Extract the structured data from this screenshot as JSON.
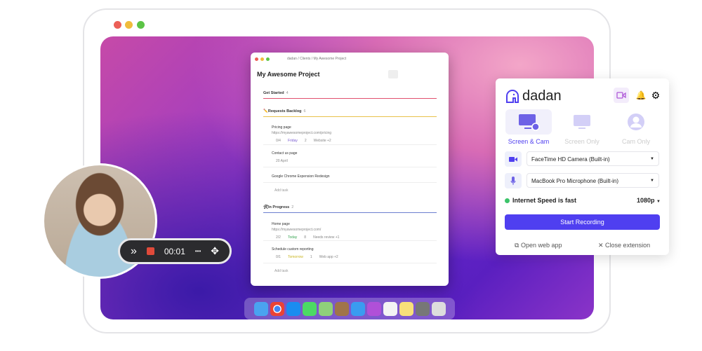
{
  "project_window": {
    "breadcrumb": "dadan / Clients / My Awesome Project",
    "title": "My Awesome Project",
    "sections": [
      {
        "icon": "",
        "name": "Get Started",
        "count": "4",
        "color": "#e0506e"
      },
      {
        "icon": "✏️",
        "name": "Requests Backlog",
        "count": "6",
        "color": "#e9c24a"
      },
      {
        "icon": "🛠",
        "name": "In Progress",
        "count": "2",
        "color": "#6b7fd0"
      }
    ],
    "tasks": [
      {
        "title": "Pricing page",
        "url": "https://myawesomeproject.com/pricing",
        "meta": [
          "0/4",
          "Friday",
          "2",
          "Website +2"
        ]
      },
      {
        "title": "Contact us page",
        "meta": [
          "20 April"
        ]
      },
      {
        "title": "Google Chrome Expension Redesign"
      },
      {
        "title": "Home page",
        "url": "https://myawesomeproject.com/",
        "meta": [
          "2/2",
          "Today",
          "8",
          "Needs review +1"
        ]
      },
      {
        "title": "Schedule custom reporting",
        "meta": [
          "0/1",
          "Tomorrow",
          "1",
          "Web app +2"
        ]
      }
    ],
    "add_task": "Add task"
  },
  "panel": {
    "brand": "dadan",
    "modes": [
      "Screen & Cam",
      "Screen Only",
      "Cam Only"
    ],
    "camera": "FaceTime HD Camera (Built-in)",
    "microphone": "MacBook Pro Microphone (Built-in)",
    "speed": "Internet Speed is fast",
    "resolution": "1080p",
    "start": "Start Recording",
    "open_web": "Open web app",
    "close": "Close extension",
    "accent": "#4f3ff0"
  },
  "recorder": {
    "time": "00:01",
    "more": "•••"
  }
}
